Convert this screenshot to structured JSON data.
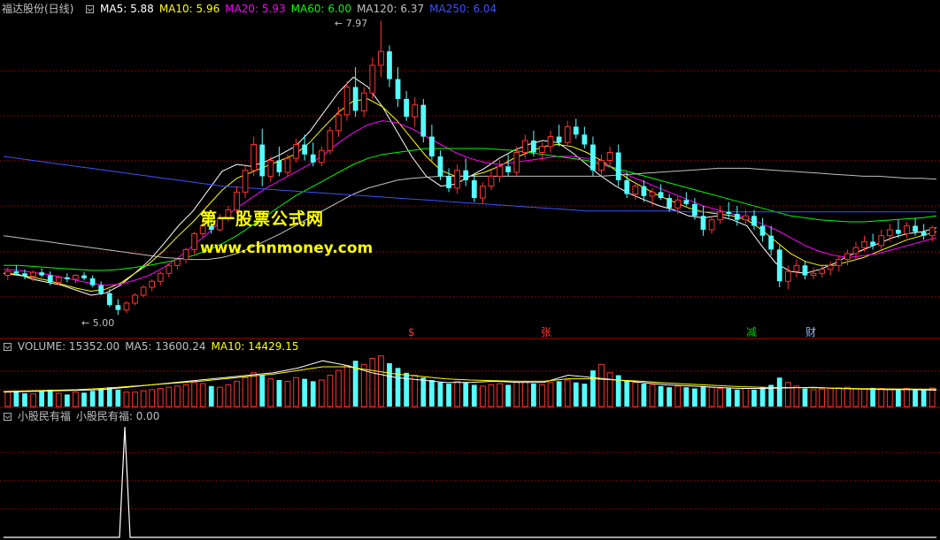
{
  "price_panel": {
    "title": "福达股份(日线)",
    "ma_labels": [
      {
        "text": "MA5: 5.88",
        "color": "#ffffff"
      },
      {
        "text": "MA10: 5.96",
        "color": "#ffff00"
      },
      {
        "text": "MA20: 5.93",
        "color": "#ff00ff"
      },
      {
        "text": "MA60: 6.00",
        "color": "#00ff00"
      },
      {
        "text": "MA120: 6.37",
        "color": "#c0c0c0"
      },
      {
        "text": "MA250: 6.04",
        "color": "#3c50ff"
      }
    ],
    "high_label": "7.97",
    "low_label": "5.00",
    "event_marks": [
      {
        "text": "$",
        "color": "#ff3030"
      },
      {
        "text": "张",
        "color": "#ff3030"
      },
      {
        "text": "减",
        "color": "#00d000"
      },
      {
        "text": "财",
        "color": "#8ab4ff"
      }
    ],
    "watermark_cn": "第一股票公式网",
    "watermark_url": "www.chnmoney.com"
  },
  "volume_panel": {
    "labels": [
      {
        "text": "VOLUME: 15352.00",
        "color": "#c0c0c0"
      },
      {
        "text": "MA5: 13600.24",
        "color": "#c0c0c0"
      },
      {
        "text": "MA10: 14429.15",
        "color": "#ffff00"
      }
    ]
  },
  "indicator_panel": {
    "labels": [
      {
        "text": "小股民有福",
        "color": "#c0c0c0"
      },
      {
        "text": "小股民有福: 0.00",
        "color": "#c0c0c0"
      }
    ]
  },
  "colors": {
    "up": "#ff3232",
    "down": "#54ffff",
    "grid": "#8b0000",
    "separator": "#b00000",
    "ma5": "#ffffff",
    "ma10": "#ffff00",
    "ma20": "#ff00ff",
    "ma60": "#00ff00",
    "ma120": "#c0c0c0",
    "ma250": "#3c50ff"
  },
  "chart_data": {
    "type": "candlestick",
    "candles": [
      [
        5.4,
        5.48,
        5.35,
        5.44
      ],
      [
        5.44,
        5.5,
        5.4,
        5.42
      ],
      [
        5.42,
        5.46,
        5.36,
        5.39
      ],
      [
        5.39,
        5.45,
        5.34,
        5.43
      ],
      [
        5.43,
        5.47,
        5.38,
        5.4
      ],
      [
        5.4,
        5.44,
        5.3,
        5.33
      ],
      [
        5.33,
        5.4,
        5.3,
        5.38
      ],
      [
        5.38,
        5.42,
        5.33,
        5.36
      ],
      [
        5.36,
        5.41,
        5.32,
        5.4
      ],
      [
        5.4,
        5.43,
        5.35,
        5.37
      ],
      [
        5.37,
        5.4,
        5.28,
        5.3
      ],
      [
        5.3,
        5.34,
        5.2,
        5.22
      ],
      [
        5.22,
        5.26,
        5.08,
        5.1
      ],
      [
        5.1,
        5.16,
        5.0,
        5.05
      ],
      [
        5.05,
        5.14,
        5.02,
        5.12
      ],
      [
        5.12,
        5.22,
        5.1,
        5.2
      ],
      [
        5.2,
        5.3,
        5.18,
        5.28
      ],
      [
        5.28,
        5.36,
        5.24,
        5.34
      ],
      [
        5.34,
        5.44,
        5.3,
        5.42
      ],
      [
        5.42,
        5.52,
        5.38,
        5.5
      ],
      [
        5.5,
        5.58,
        5.46,
        5.56
      ],
      [
        5.56,
        5.68,
        5.52,
        5.66
      ],
      [
        5.66,
        5.84,
        5.62,
        5.82
      ],
      [
        5.82,
        5.95,
        5.78,
        5.9
      ],
      [
        5.9,
        6.0,
        5.82,
        5.86
      ],
      [
        5.86,
        6.02,
        5.84,
        5.98
      ],
      [
        5.98,
        6.1,
        5.94,
        6.06
      ],
      [
        6.06,
        6.3,
        6.02,
        6.24
      ],
      [
        6.24,
        6.52,
        6.18,
        6.46
      ],
      [
        6.46,
        6.8,
        6.4,
        6.72
      ],
      [
        6.72,
        6.88,
        6.3,
        6.4
      ],
      [
        6.4,
        6.6,
        6.34,
        6.56
      ],
      [
        6.56,
        6.7,
        6.4,
        6.44
      ],
      [
        6.44,
        6.62,
        6.4,
        6.58
      ],
      [
        6.58,
        6.78,
        6.54,
        6.72
      ],
      [
        6.72,
        6.82,
        6.56,
        6.62
      ],
      [
        6.62,
        6.74,
        6.5,
        6.54
      ],
      [
        6.54,
        6.7,
        6.5,
        6.66
      ],
      [
        6.66,
        6.9,
        6.62,
        6.86
      ],
      [
        6.86,
        7.1,
        6.8,
        7.02
      ],
      [
        7.02,
        7.36,
        6.96,
        7.3
      ],
      [
        7.3,
        7.5,
        7.0,
        7.06
      ],
      [
        7.06,
        7.3,
        7.0,
        7.24
      ],
      [
        7.24,
        7.6,
        7.18,
        7.52
      ],
      [
        7.52,
        7.97,
        7.4,
        7.66
      ],
      [
        7.66,
        7.72,
        7.3,
        7.38
      ],
      [
        7.38,
        7.5,
        7.1,
        7.18
      ],
      [
        7.18,
        7.26,
        6.96,
        7.0
      ],
      [
        7.0,
        7.2,
        6.9,
        7.12
      ],
      [
        7.12,
        7.18,
        6.74,
        6.8
      ],
      [
        6.8,
        6.92,
        6.56,
        6.6
      ],
      [
        6.6,
        6.66,
        6.36,
        6.4
      ],
      [
        6.4,
        6.48,
        6.24,
        6.28
      ],
      [
        6.28,
        6.52,
        6.22,
        6.46
      ],
      [
        6.46,
        6.58,
        6.3,
        6.36
      ],
      [
        6.36,
        6.42,
        6.14,
        6.18
      ],
      [
        6.18,
        6.34,
        6.12,
        6.3
      ],
      [
        6.3,
        6.46,
        6.26,
        6.4
      ],
      [
        6.4,
        6.56,
        6.34,
        6.5
      ],
      [
        6.5,
        6.62,
        6.4,
        6.44
      ],
      [
        6.44,
        6.7,
        6.4,
        6.64
      ],
      [
        6.64,
        6.82,
        6.58,
        6.76
      ],
      [
        6.76,
        6.86,
        6.6,
        6.64
      ],
      [
        6.64,
        6.74,
        6.56,
        6.7
      ],
      [
        6.7,
        6.86,
        6.64,
        6.8
      ],
      [
        6.8,
        6.92,
        6.7,
        6.74
      ],
      [
        6.74,
        6.96,
        6.7,
        6.9
      ],
      [
        6.9,
        6.98,
        6.78,
        6.82
      ],
      [
        6.82,
        6.9,
        6.68,
        6.72
      ],
      [
        6.72,
        6.8,
        6.4,
        6.46
      ],
      [
        6.46,
        6.62,
        6.4,
        6.56
      ],
      [
        6.56,
        6.7,
        6.5,
        6.64
      ],
      [
        6.64,
        6.72,
        6.3,
        6.36
      ],
      [
        6.36,
        6.44,
        6.18,
        6.22
      ],
      [
        6.22,
        6.34,
        6.16,
        6.3
      ],
      [
        6.3,
        6.36,
        6.14,
        6.2
      ],
      [
        6.2,
        6.28,
        6.1,
        6.24
      ],
      [
        6.24,
        6.32,
        6.16,
        6.18
      ],
      [
        6.18,
        6.22,
        6.04,
        6.08
      ],
      [
        6.08,
        6.2,
        6.02,
        6.16
      ],
      [
        6.16,
        6.24,
        6.1,
        6.12
      ],
      [
        6.12,
        6.18,
        5.96,
        6.0
      ],
      [
        6.0,
        6.1,
        5.8,
        5.86
      ],
      [
        5.86,
        6.0,
        5.82,
        5.96
      ],
      [
        5.96,
        6.1,
        5.92,
        6.04
      ],
      [
        6.04,
        6.14,
        5.98,
        6.02
      ],
      [
        6.02,
        6.1,
        5.9,
        5.96
      ],
      [
        5.96,
        6.06,
        5.92,
        6.0
      ],
      [
        6.0,
        6.06,
        5.86,
        5.9
      ],
      [
        5.9,
        5.98,
        5.74,
        5.8
      ],
      [
        5.8,
        5.9,
        5.6,
        5.66
      ],
      [
        5.66,
        5.7,
        5.28,
        5.34
      ],
      [
        5.34,
        5.5,
        5.26,
        5.44
      ],
      [
        5.44,
        5.56,
        5.38,
        5.5
      ],
      [
        5.5,
        5.54,
        5.36,
        5.4
      ],
      [
        5.4,
        5.48,
        5.36,
        5.42
      ],
      [
        5.42,
        5.5,
        5.38,
        5.46
      ],
      [
        5.46,
        5.54,
        5.4,
        5.5
      ],
      [
        5.5,
        5.6,
        5.44,
        5.56
      ],
      [
        5.56,
        5.66,
        5.5,
        5.62
      ],
      [
        5.62,
        5.74,
        5.56,
        5.68
      ],
      [
        5.68,
        5.8,
        5.64,
        5.74
      ],
      [
        5.74,
        5.82,
        5.66,
        5.7
      ],
      [
        5.7,
        5.86,
        5.66,
        5.8
      ],
      [
        5.8,
        5.92,
        5.74,
        5.86
      ],
      [
        5.86,
        5.96,
        5.78,
        5.82
      ],
      [
        5.82,
        5.94,
        5.78,
        5.9
      ],
      [
        5.9,
        5.98,
        5.8,
        5.84
      ],
      [
        5.84,
        5.92,
        5.76,
        5.8
      ],
      [
        5.8,
        5.9,
        5.74,
        5.88
      ]
    ],
    "ma": {
      "ma5": [
        5.42,
        5.41,
        5.36,
        5.33,
        5.3,
        5.25,
        5.2,
        5.22,
        5.3,
        5.42,
        5.55,
        5.72,
        5.9,
        6.05,
        6.25,
        6.45,
        6.52,
        6.5,
        6.55,
        6.62,
        6.7,
        6.85,
        7.05,
        7.25,
        7.4,
        7.3,
        7.1,
        6.85,
        6.6,
        6.4,
        6.3,
        6.32,
        6.4,
        6.48,
        6.58,
        6.66,
        6.72,
        6.76,
        6.74,
        6.64,
        6.52,
        6.4,
        6.3,
        6.22,
        6.16,
        6.1,
        6.06,
        6.0,
        5.98,
        6.0,
        5.96,
        5.9,
        5.7,
        5.52,
        5.44,
        5.42,
        5.46,
        5.52,
        5.6,
        5.66,
        5.72,
        5.78,
        5.82,
        5.84,
        5.88
      ],
      "ma10": [
        5.42,
        5.4,
        5.38,
        5.35,
        5.31,
        5.27,
        5.24,
        5.26,
        5.32,
        5.42,
        5.52,
        5.65,
        5.8,
        5.94,
        6.1,
        6.26,
        6.38,
        6.44,
        6.5,
        6.56,
        6.62,
        6.74,
        6.9,
        7.05,
        7.16,
        7.18,
        7.1,
        6.96,
        6.78,
        6.6,
        6.46,
        6.4,
        6.4,
        6.44,
        6.5,
        6.58,
        6.64,
        6.7,
        6.72,
        6.7,
        6.64,
        6.56,
        6.46,
        6.36,
        6.28,
        6.2,
        6.14,
        6.08,
        6.04,
        6.02,
        6.0,
        5.96,
        5.86,
        5.74,
        5.62,
        5.54,
        5.5,
        5.5,
        5.54,
        5.58,
        5.64,
        5.7,
        5.76,
        5.8,
        5.84
      ],
      "ma20": [
        5.46,
        5.45,
        5.43,
        5.41,
        5.38,
        5.35,
        5.32,
        5.3,
        5.31,
        5.35,
        5.4,
        5.48,
        5.58,
        5.7,
        5.82,
        5.96,
        6.08,
        6.18,
        6.28,
        6.36,
        6.44,
        6.52,
        6.62,
        6.74,
        6.84,
        6.92,
        6.96,
        6.94,
        6.88,
        6.8,
        6.72,
        6.64,
        6.58,
        6.54,
        6.52,
        6.54,
        6.56,
        6.58,
        6.6,
        6.6,
        6.58,
        6.54,
        6.48,
        6.4,
        6.34,
        6.28,
        6.22,
        6.16,
        6.1,
        6.06,
        6.02,
        5.98,
        5.92,
        5.86,
        5.78,
        5.7,
        5.64,
        5.6,
        5.58,
        5.6,
        5.62,
        5.66,
        5.7,
        5.74,
        5.78
      ],
      "ma60": [
        5.5,
        5.5,
        5.49,
        5.48,
        5.47,
        5.46,
        5.45,
        5.45,
        5.46,
        5.48,
        5.5,
        5.53,
        5.56,
        5.6,
        5.65,
        5.72,
        5.8,
        5.9,
        6.0,
        6.1,
        6.2,
        6.28,
        6.36,
        6.44,
        6.52,
        6.58,
        6.62,
        6.64,
        6.66,
        6.68,
        6.68,
        6.68,
        6.68,
        6.68,
        6.67,
        6.66,
        6.64,
        6.62,
        6.6,
        6.58,
        6.56,
        6.52,
        6.48,
        6.44,
        6.4,
        6.36,
        6.32,
        6.28,
        6.24,
        6.2,
        6.16,
        6.12,
        6.08,
        6.04,
        6.0,
        5.98,
        5.96,
        5.95,
        5.94,
        5.94,
        5.95,
        5.96,
        5.97,
        5.98,
        6.0
      ],
      "ma120": [
        5.8,
        5.78,
        5.76,
        5.74,
        5.72,
        5.7,
        5.68,
        5.66,
        5.64,
        5.62,
        5.6,
        5.58,
        5.57,
        5.56,
        5.56,
        5.58,
        5.62,
        5.68,
        5.75,
        5.82,
        5.9,
        5.98,
        6.06,
        6.14,
        6.22,
        6.28,
        6.32,
        6.36,
        6.38,
        6.39,
        6.4,
        6.4,
        6.4,
        6.4,
        6.4,
        6.4,
        6.4,
        6.4,
        6.4,
        6.4,
        6.4,
        6.4,
        6.41,
        6.42,
        6.43,
        6.44,
        6.45,
        6.46,
        6.47,
        6.48,
        6.48,
        6.48,
        6.47,
        6.46,
        6.45,
        6.44,
        6.43,
        6.42,
        6.41,
        6.4,
        6.4,
        6.39,
        6.38,
        6.38,
        6.37
      ],
      "ma250": [
        6.6,
        6.58,
        6.56,
        6.54,
        6.52,
        6.5,
        6.48,
        6.46,
        6.44,
        6.42,
        6.4,
        6.38,
        6.36,
        6.34,
        6.32,
        6.3,
        6.29,
        6.28,
        6.27,
        6.26,
        6.25,
        6.24,
        6.23,
        6.22,
        6.21,
        6.2,
        6.19,
        6.18,
        6.17,
        6.16,
        6.15,
        6.14,
        6.13,
        6.12,
        6.11,
        6.1,
        6.09,
        6.08,
        6.07,
        6.06,
        6.05,
        6.05,
        6.05,
        6.05,
        6.05,
        6.05,
        6.05,
        6.04,
        6.04,
        6.04,
        6.04,
        6.04,
        6.04,
        6.04,
        6.04,
        6.04,
        6.04,
        6.04,
        6.04,
        6.04,
        6.04,
        6.04,
        6.04,
        6.04,
        6.04
      ]
    },
    "volume": [
      12000,
      13000,
      11000,
      10500,
      12500,
      14000,
      11000,
      10000,
      12000,
      11500,
      13000,
      15000,
      16000,
      14000,
      12000,
      12000,
      13000,
      14000,
      15000,
      16000,
      17000,
      18000,
      20000,
      19000,
      17000,
      16000,
      18000,
      21000,
      24000,
      28000,
      26000,
      23000,
      22000,
      21000,
      24000,
      23000,
      21000,
      22000,
      26000,
      30000,
      34000,
      38000,
      35000,
      40000,
      42000,
      36000,
      32000,
      28000,
      26000,
      24000,
      22000,
      20000,
      19000,
      21000,
      20000,
      18000,
      17000,
      18000,
      19000,
      18000,
      20000,
      21000,
      19000,
      18000,
      20000,
      21000,
      22000,
      20000,
      19000,
      30000,
      35000,
      28000,
      26000,
      22000,
      20000,
      19000,
      18000,
      17000,
      16000,
      17000,
      16000,
      15000,
      17000,
      16000,
      15000,
      15000,
      14000,
      15000,
      14000,
      16000,
      18000,
      24000,
      20000,
      17000,
      15000,
      14000,
      14500,
      15000,
      15500,
      16000,
      15000,
      14500,
      15500,
      15000,
      14500,
      14000,
      15000,
      14500,
      14000,
      15352
    ],
    "volume_ma5": [
      12000,
      12500,
      13000,
      13500,
      14000,
      16000,
      18000,
      20000,
      22000,
      24000,
      26000,
      28000,
      32000,
      38000,
      34000,
      28000,
      24000,
      22000,
      20000,
      20000,
      21000,
      20000,
      20000,
      26000,
      24000,
      22000,
      20000,
      18000,
      17000,
      16000,
      15000,
      15000,
      15500,
      16000,
      15000,
      14500,
      14000,
      14000,
      13600
    ],
    "volume_ma10": [
      12500,
      13000,
      13500,
      14000,
      15000,
      16500,
      18000,
      19500,
      21000,
      23000,
      25000,
      27000,
      30000,
      33000,
      33000,
      30000,
      27000,
      25000,
      23000,
      22000,
      21500,
      21000,
      21000,
      23000,
      23000,
      22000,
      21000,
      19500,
      18500,
      17500,
      16500,
      16000,
      15800,
      15600,
      15200,
      14800,
      14600,
      14500,
      14430
    ],
    "indicator": {
      "name": "小股民有福",
      "value": 0.0,
      "spike_at_fraction": 0.13,
      "spike_value": 1
    }
  }
}
